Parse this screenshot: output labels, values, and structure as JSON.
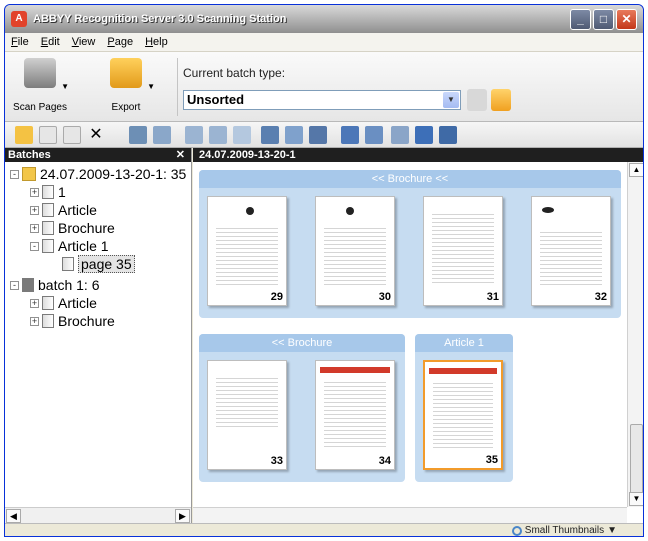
{
  "window": {
    "title": "ABBYY Recognition Server 3.0 Scanning Station",
    "controls": {
      "minimize": "_",
      "maximize": "□",
      "close": "✕"
    }
  },
  "menu": [
    {
      "pre": "",
      "u": "F",
      "post": "ile"
    },
    {
      "pre": "",
      "u": "E",
      "post": "dit"
    },
    {
      "pre": "",
      "u": "V",
      "post": "iew"
    },
    {
      "pre": "",
      "u": "P",
      "post": "age"
    },
    {
      "pre": "",
      "u": "H",
      "post": "elp"
    }
  ],
  "ribbon": {
    "scan_label": "Scan Pages",
    "export_label": "Export",
    "batch_type_label": "Current batch type:",
    "batch_type_value": "Unsorted"
  },
  "batches_panel": {
    "title": "Batches",
    "close": "✕",
    "tree": [
      {
        "label": "24.07.2009-13-20-1: 35",
        "level": 0,
        "icon": "folder",
        "expander": "-"
      },
      {
        "label": "1",
        "level": 1,
        "icon": "doc",
        "expander": "+"
      },
      {
        "label": "Article",
        "level": 1,
        "icon": "doc",
        "expander": "+"
      },
      {
        "label": "Brochure",
        "level": 1,
        "icon": "doc",
        "expander": "+"
      },
      {
        "label": "Article 1",
        "level": 1,
        "icon": "doc",
        "expander": "-"
      },
      {
        "label": "page 35",
        "level": 2,
        "icon": "page",
        "expander": "",
        "selected": true
      },
      {
        "label": "batch 1: 6",
        "level": 0,
        "icon": "batch",
        "expander": "-"
      },
      {
        "label": "Article",
        "level": 1,
        "icon": "doc",
        "expander": "+"
      },
      {
        "label": "Brochure",
        "level": 1,
        "icon": "doc",
        "expander": "+"
      }
    ]
  },
  "pages_panel": {
    "title": "24.07.2009-13-20-1",
    "groups": [
      {
        "label": "<< Brochure <<",
        "pages": [
          "29",
          "30",
          "31",
          "32"
        ]
      },
      {
        "label": "<< Brochure",
        "pages": [
          "33",
          "34"
        ]
      },
      {
        "label": "Article 1",
        "pages": [
          "35"
        ]
      }
    ]
  },
  "statusbar": {
    "view_mode": "Small Thumbnails"
  },
  "colors": {
    "group_bg": "#c6dcf1",
    "group_tab": "#a7c8ea",
    "selection": "#f29b2b",
    "panel_header": "#1f1f1f"
  }
}
